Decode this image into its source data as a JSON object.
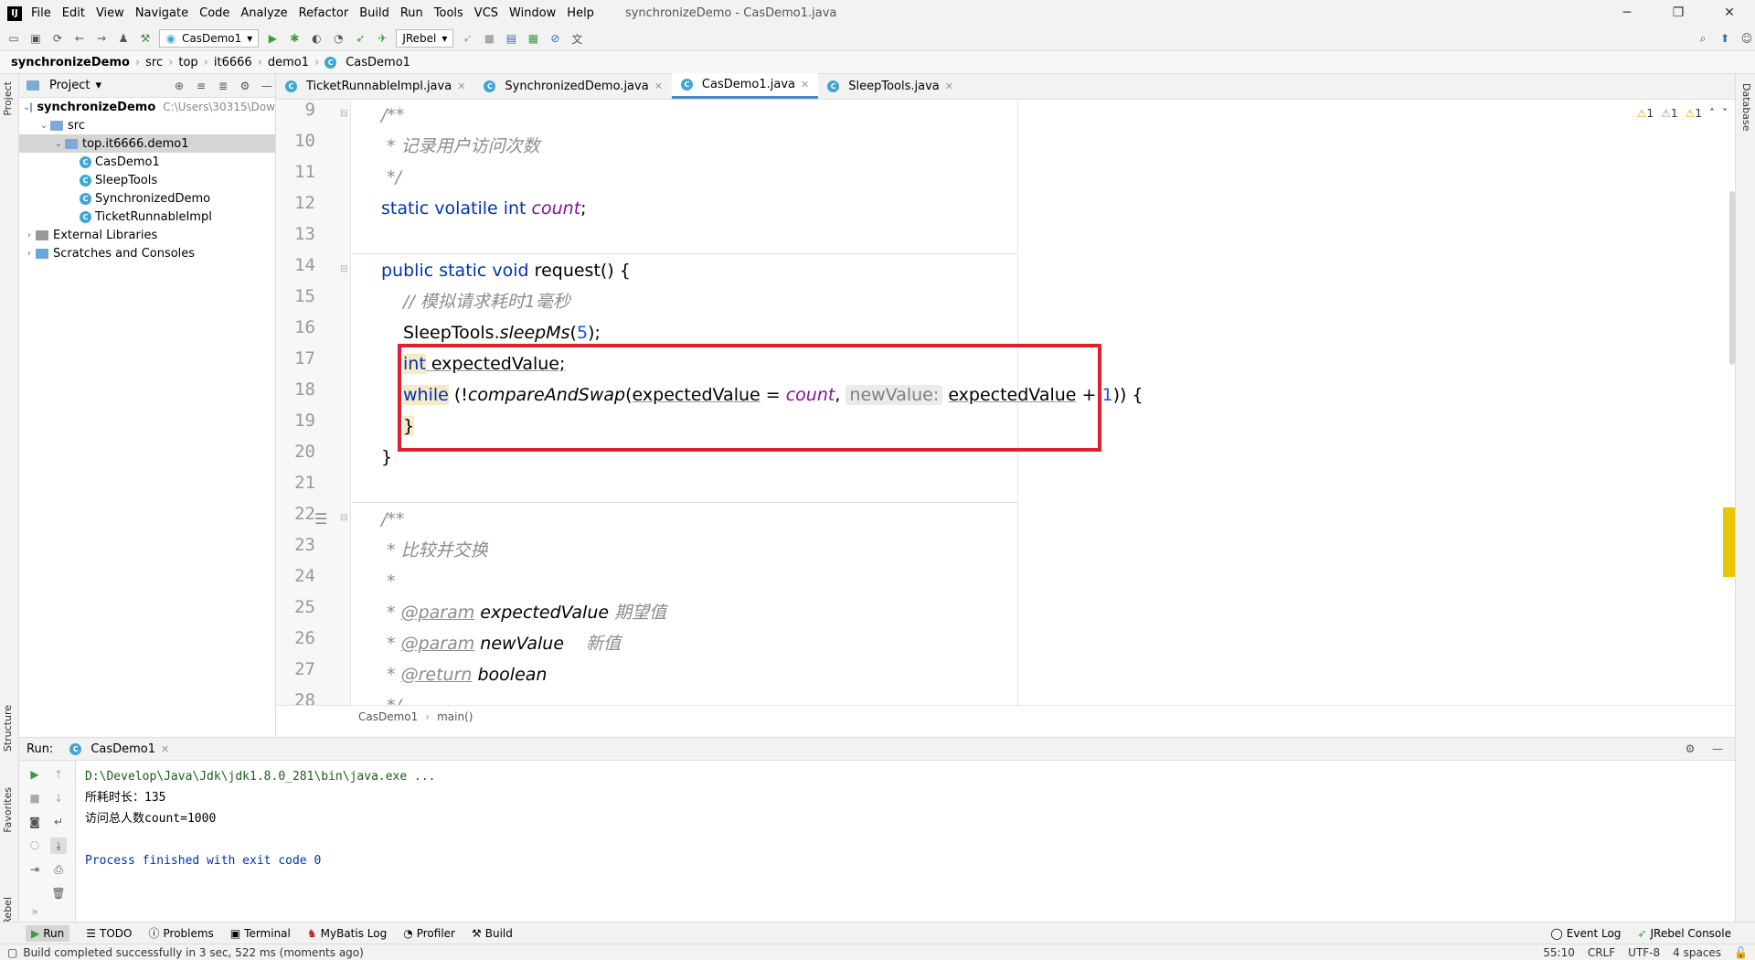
{
  "window": {
    "title": "synchronizeDemo - CasDemo1.java",
    "controls": [
      "─",
      "❐",
      "✕"
    ]
  },
  "menu": [
    "File",
    "Edit",
    "View",
    "Navigate",
    "Code",
    "Analyze",
    "Refactor",
    "Build",
    "Run",
    "Tools",
    "VCS",
    "Window",
    "Help"
  ],
  "toolbar": {
    "run_config": "CasDemo1",
    "jrebel": "JRebel"
  },
  "navbar": [
    "synchronizeDemo",
    "src",
    "top",
    "it6666",
    "demo1",
    "CasDemo1"
  ],
  "project": {
    "header": "Project",
    "tree": [
      {
        "label": "synchronizeDemo",
        "extra": "C:\\Users\\30315\\Dow",
        "indent": 0,
        "type": "module",
        "expanded": true
      },
      {
        "label": "src",
        "indent": 1,
        "type": "folder",
        "expanded": true
      },
      {
        "label": "top.it6666.demo1",
        "indent": 2,
        "type": "package",
        "expanded": true,
        "selected": true
      },
      {
        "label": "CasDemo1",
        "indent": 3,
        "type": "class"
      },
      {
        "label": "SleepTools",
        "indent": 3,
        "type": "class"
      },
      {
        "label": "SynchronizedDemo",
        "indent": 3,
        "type": "class"
      },
      {
        "label": "TicketRunnableImpl",
        "indent": 3,
        "type": "class"
      },
      {
        "label": "External Libraries",
        "indent": 0,
        "type": "lib",
        "expanded": false
      },
      {
        "label": "Scratches and Consoles",
        "indent": 0,
        "type": "scratch",
        "expanded": false
      }
    ]
  },
  "editor_tabs": [
    {
      "label": "TicketRunnableImpl.java",
      "active": false
    },
    {
      "label": "SynchronizedDemo.java",
      "active": false
    },
    {
      "label": "CasDemo1.java",
      "active": true
    },
    {
      "label": "SleepTools.java",
      "active": false
    }
  ],
  "inspections": {
    "w1": "1",
    "w2": "1",
    "w3": "1"
  },
  "code_lines": [
    "9",
    "10",
    "11",
    "12",
    "13",
    "14",
    "15",
    "16",
    "17",
    "18",
    "19",
    "20",
    "21",
    "22",
    "23",
    "24",
    "25",
    "26",
    "27",
    "28"
  ],
  "code": {
    "l9": "/**",
    "l10": " * 记录用户访问次数",
    "l11": " */",
    "l12_kw": "static volatile int ",
    "l12_fld": "count",
    "l12_end": ";",
    "l14_kw": "public static void ",
    "l14_rest": "request() {",
    "l15": "// 模拟请求耗时1毫秒",
    "l16_a": "SleepTools.",
    "l16_m": "sleepMs",
    "l16_b": "(",
    "l16_n": "5",
    "l16_c": ");",
    "l17_kw": "int",
    "l17_rest": " expectedValue;",
    "l18_kw": "while",
    "l18_a": " (!",
    "l18_m": "compareAndSwap",
    "l18_b": "(",
    "l18_v": "expectedValue",
    "l18_c": " = ",
    "l18_f": "count",
    "l18_d": ", ",
    "l18_hint": "newValue:",
    "l18_e": " ",
    "l18_v2": "expectedValue",
    "l18_g": " + ",
    "l18_n": "1",
    "l18_h": ")) {",
    "l19": "}",
    "l20": "}",
    "l22": "/**",
    "l23": " * 比较并交换",
    "l24": " *",
    "l25_a": " * ",
    "l25_t": "@param",
    "l25_b": " expectedValue ",
    "l25_c": "期望值",
    "l26_a": " * ",
    "l26_t": "@param",
    "l26_b": " newValue    ",
    "l26_c": "新值",
    "l27_a": " * ",
    "l27_t": "@return",
    "l27_b": " boolean",
    "l28": " */"
  },
  "editor_breadcrumb": [
    "CasDemo1",
    "main()"
  ],
  "run": {
    "label": "Run:",
    "tab": "CasDemo1",
    "console": [
      "D:\\Develop\\Java\\Jdk\\jdk1.8.0_281\\bin\\java.exe ...",
      "所耗时长：135",
      "访问总人数count=1000",
      "",
      "Process finished with exit code 0"
    ]
  },
  "bottom_tabs": [
    "Run",
    "TODO",
    "Problems",
    "Terminal",
    "MyBatis Log",
    "Profiler",
    "Build"
  ],
  "bottom_right_tabs": [
    "Event Log",
    "JRebel Console"
  ],
  "side_tabs": {
    "project": "Project",
    "structure": "Structure",
    "favorites": "Favorites",
    "jrebel": "JRebel",
    "database": "Database"
  },
  "status": {
    "message": "Build completed successfully in 3 sec, 522 ms (moments ago)",
    "position": "55:10",
    "line_sep": "CRLF",
    "encoding": "UTF-8",
    "indent": "4 spaces"
  }
}
